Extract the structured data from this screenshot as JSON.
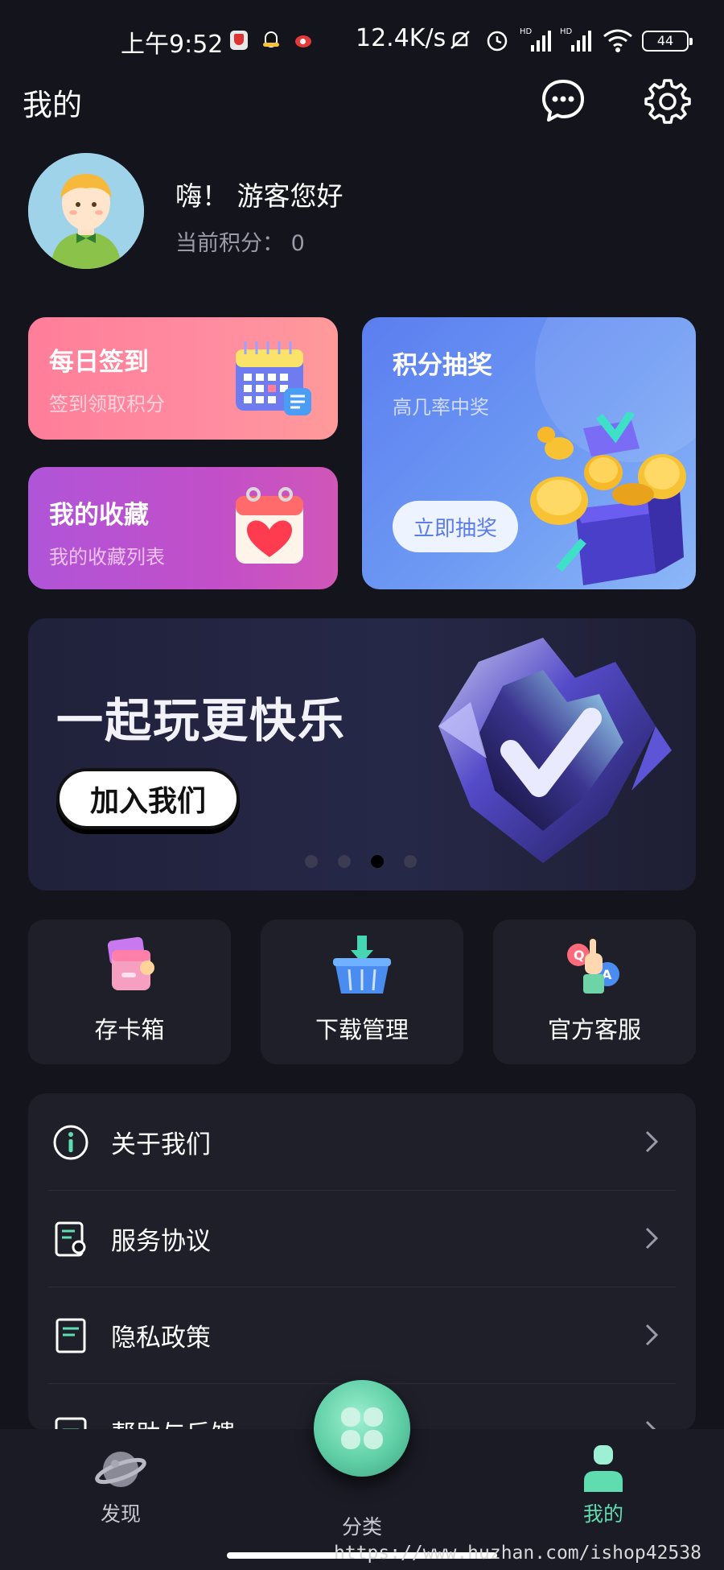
{
  "status_bar": {
    "time": "上午9:52",
    "net_speed": "12.4K/s",
    "battery": "44",
    "icons": [
      "shield-icon",
      "qq-icon",
      "weibo-icon",
      "mute-icon",
      "alarm-icon",
      "signal-hd-icon",
      "signal-hd-icon",
      "wifi-icon",
      "battery-icon"
    ]
  },
  "header": {
    "title": "我的",
    "icons": [
      "message-icon",
      "settings-icon"
    ]
  },
  "profile": {
    "greeting": "嗨！ 游客您好",
    "points": "当前积分：  0"
  },
  "cards": {
    "checkin": {
      "title": "每日签到",
      "subtitle": "签到领取积分",
      "icon": "calendar-icon"
    },
    "favorites": {
      "title": "我的收藏",
      "subtitle": "我的收藏列表",
      "icon": "heart-calendar-icon"
    },
    "lottery": {
      "title": "积分抽奖",
      "subtitle": "高几率中奖",
      "button": "立即抽奖",
      "icon": "gift-coins-icon"
    }
  },
  "banner": {
    "title": "一起玩更快乐",
    "button": "加入我们",
    "dots": 4,
    "active_dot": 3
  },
  "tiles": [
    {
      "label": "存卡箱",
      "icon": "card-wallet-icon"
    },
    {
      "label": "下载管理",
      "icon": "download-basket-icon"
    },
    {
      "label": "官方客服",
      "icon": "customer-service-icon"
    }
  ],
  "menu": [
    {
      "label": "关于我们",
      "icon": "info-icon"
    },
    {
      "label": "服务协议",
      "icon": "agreement-icon"
    },
    {
      "label": "隐私政策",
      "icon": "policy-doc-icon"
    },
    {
      "label": "帮助与反馈",
      "icon": "help-icon"
    }
  ],
  "bottom_nav": {
    "items": [
      {
        "label": "发现",
        "icon": "planet-icon",
        "active": false
      },
      {
        "label": "分类",
        "icon": "clover-icon",
        "active": false
      },
      {
        "label": "我的",
        "icon": "user-icon",
        "active": true
      }
    ]
  },
  "watermark": "https://www.huzhan.com/ishop42538",
  "colors": {
    "background": "#14141d",
    "surface": "#1e1f29",
    "accent_green": "#5fdcb0",
    "checkin_gradient": [
      "#ff8fa3",
      "#ff6f8e"
    ],
    "favorites_gradient": [
      "#b85bd6",
      "#d04fc0"
    ],
    "lottery_gradient": [
      "#5c7ff0",
      "#8ab6f7"
    ]
  }
}
